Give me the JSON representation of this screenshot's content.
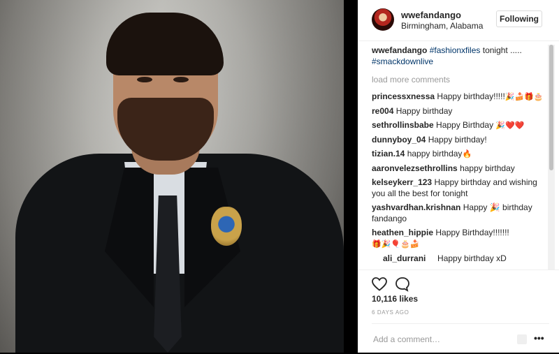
{
  "post": {
    "username": "wwefandango",
    "location": "Birmingham, Alabama",
    "follow_label": "Following",
    "caption": {
      "user": "wwefandango",
      "hashtag1": "#fashionxfiles",
      "text": " tonight .....",
      "hashtag2": "#smackdownlive"
    },
    "load_more": "load more comments",
    "comments": [
      {
        "user": "princessxnessa",
        "text": "Happy birthday!!!!!",
        "emoji": "🎉🍰🎁🎂"
      },
      {
        "user": "re004",
        "text": "Happy birthday",
        "emoji": ""
      },
      {
        "user": "sethrollinsbabe",
        "text": "Happy Birthday",
        "emoji": "🎉❤️❤️"
      },
      {
        "user": "dunnyboy_04",
        "text": "Happy birthday!",
        "emoji": ""
      },
      {
        "user": "tizian.14",
        "text": "happy birthday",
        "emoji": "🔥"
      },
      {
        "user": "aaronvelezsethrollins",
        "text": "happy birthday",
        "emoji": ""
      },
      {
        "user": "kelseykerr_123",
        "text": "Happy birthday and wishing you all the best for tonight",
        "emoji": ""
      },
      {
        "user": "yashvardhan.krishnan",
        "text": "Happy 🎉 birthday fandango",
        "emoji": ""
      },
      {
        "user": "heathen_hippie",
        "text": "Happy Birthday!!!!!!!",
        "emoji": "🎁🎉🎈🎂🍰"
      },
      {
        "user": "ali_durrani",
        "text": "Happy birthday xD",
        "emoji": ""
      }
    ],
    "likes": "10,116 likes",
    "time": "6 DAYS AGO",
    "add_comment_placeholder": "Add a comment…",
    "more": "•••"
  }
}
